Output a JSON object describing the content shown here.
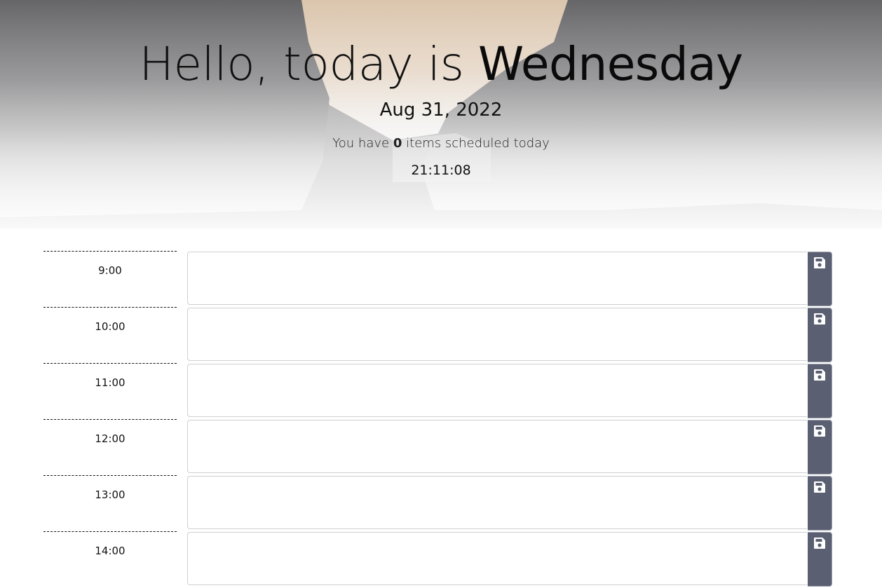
{
  "header": {
    "greeting_prefix": "Hello, today is ",
    "day_name": "Wednesday",
    "date": "Aug 31, 2022",
    "summary_prefix": "You have ",
    "item_count": "0",
    "summary_suffix": " items scheduled today",
    "clock": "21:11:08"
  },
  "planner": {
    "rows": [
      {
        "hour": "9:00",
        "entry": "",
        "save_icon": "floppy-disk-icon"
      },
      {
        "hour": "10:00",
        "entry": "",
        "save_icon": "floppy-disk-icon"
      },
      {
        "hour": "11:00",
        "entry": "",
        "save_icon": "floppy-disk-icon"
      },
      {
        "hour": "12:00",
        "entry": "",
        "save_icon": "floppy-disk-icon"
      },
      {
        "hour": "13:00",
        "entry": "",
        "save_icon": "floppy-disk-icon"
      },
      {
        "hour": "14:00",
        "entry": "",
        "save_icon": "floppy-disk-icon"
      }
    ]
  },
  "colors": {
    "save_button": "#5a6072",
    "hour_divider": "#111111"
  }
}
